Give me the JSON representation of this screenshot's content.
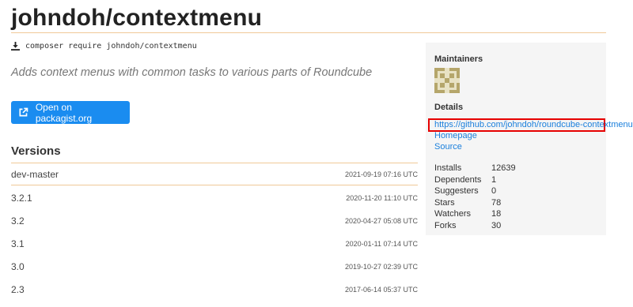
{
  "package": {
    "title": "johndoh/contextmenu",
    "composer_command": "composer require johndoh/contextmenu",
    "description": "Adds context menus with common tasks to various parts of Roundcube",
    "open_button_label": "Open on packagist.org"
  },
  "versions": {
    "heading": "Versions",
    "items": [
      {
        "name": "dev-master",
        "date": "2021-09-19 07:16 UTC"
      },
      {
        "name": "3.2.1",
        "date": "2020-11-20 11:10 UTC"
      },
      {
        "name": "3.2",
        "date": "2020-04-27 05:08 UTC"
      },
      {
        "name": "3.1",
        "date": "2020-01-11 07:14 UTC"
      },
      {
        "name": "3.0",
        "date": "2019-10-27 02:39 UTC"
      },
      {
        "name": "2.3",
        "date": "2017-06-14 05:37 UTC"
      }
    ]
  },
  "sidebar": {
    "maintainers_label": "Maintainers",
    "details_label": "Details",
    "links": {
      "repository": "https://github.com/johndoh/roundcube-contextmenu",
      "homepage": "Homepage",
      "source": "Source"
    },
    "stats": [
      {
        "label": "Installs",
        "value": "12639"
      },
      {
        "label": "Dependents",
        "value": "1"
      },
      {
        "label": "Suggesters",
        "value": "0"
      },
      {
        "label": "Stars",
        "value": "78"
      },
      {
        "label": "Watchers",
        "value": "18"
      },
      {
        "label": "Forks",
        "value": "30"
      }
    ]
  },
  "colors": {
    "accent_rule": "#f0c998",
    "button": "#1a8cf0",
    "link": "#1a7fdc",
    "highlight": "#e60000",
    "avatar": "#b5a66b"
  },
  "icons": {
    "download": "download-icon",
    "external": "external-link-icon"
  }
}
